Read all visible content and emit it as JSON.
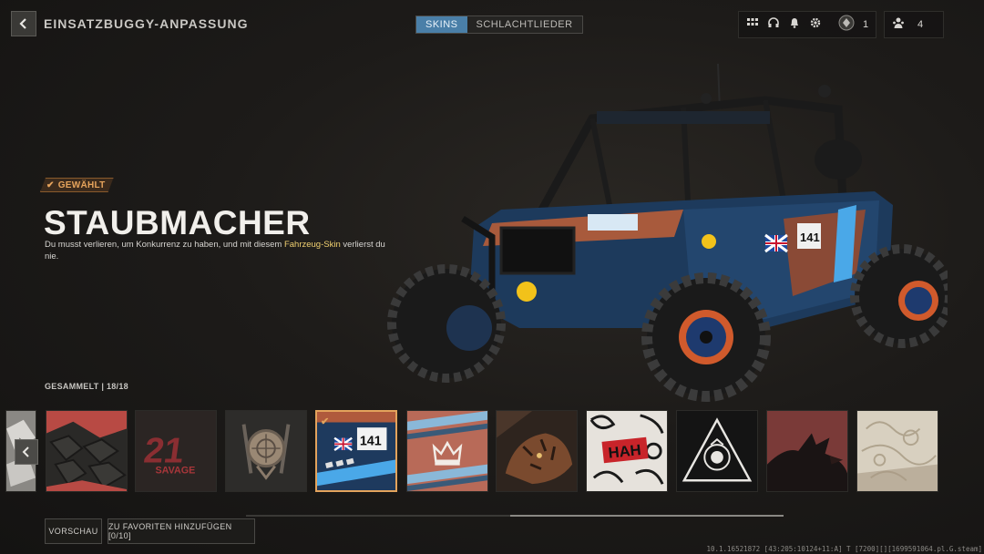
{
  "header": {
    "title": "EINSATZBUGGY-ANPASSUNG",
    "tabs": [
      {
        "label": "SKINS",
        "active": true
      },
      {
        "label": "SCHLACHTLIEDER",
        "active": false
      }
    ],
    "level": "1",
    "players": "4"
  },
  "skin": {
    "badge": "GEWÄHLT",
    "name": "STAUBMACHER",
    "description_before": "Du musst verlieren, um Konkurrenz zu haben, und mit diesem ",
    "description_highlight": "Fahrzeug-Skin",
    "description_after": " verlierst du nie.",
    "highlight_color": "#f0d070",
    "selected_color": "#e3a35c"
  },
  "collection": {
    "label": "GESAMMELT | 18/18"
  },
  "vehicle": {
    "number": "141"
  },
  "carousel": {
    "selected_index": 4,
    "items": [
      {
        "icon": "partial-camo-skin"
      },
      {
        "icon": "dark-scales-skin"
      },
      {
        "icon": "21-savage-skin",
        "text_top": "21",
        "text_bottom": "SAVAGE"
      },
      {
        "icon": "emblem-scope-skin"
      },
      {
        "icon": "staubmacher-skin",
        "text": "141"
      },
      {
        "icon": "crown-stripes-skin"
      },
      {
        "icon": "tiger-skin"
      },
      {
        "icon": "graffiti-skin",
        "text": "HAH"
      },
      {
        "icon": "triangle-emblem-skin"
      },
      {
        "icon": "dragon-skin"
      },
      {
        "icon": "ornament-skin"
      }
    ]
  },
  "buttons": {
    "preview": "VORSCHAU",
    "favorites": "ZU FAVORITEN HINZUFÜGEN [0/10]"
  },
  "build_info": "10.1.16521872 [43:205:10124+11:A] T [7200][][1699591064.pl.G.steam]"
}
